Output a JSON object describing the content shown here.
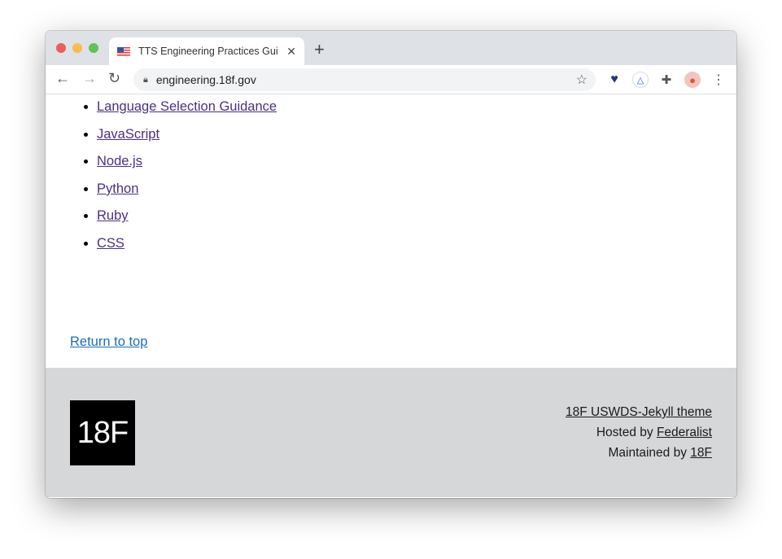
{
  "browser": {
    "tab_title": "TTS Engineering Practices Gui",
    "url": "engineering.18f.gov",
    "colors": {
      "close": "#ee5e57",
      "minimize": "#f6be4f",
      "maximize": "#5fc453"
    }
  },
  "nav_list": [
    {
      "label": "Language Selection Guidance"
    },
    {
      "label": "JavaScript"
    },
    {
      "label": "Node.js"
    },
    {
      "label": "Python"
    },
    {
      "label": "Ruby"
    },
    {
      "label": "CSS"
    }
  ],
  "return_to_top": "Return to top",
  "footer": {
    "logo_text": "18F",
    "theme_link": "18F USWDS-Jekyll theme",
    "hosted_prefix": "Hosted by ",
    "hosted_link": "Federalist",
    "maintained_prefix": "Maintained by ",
    "maintained_link": "18F"
  }
}
